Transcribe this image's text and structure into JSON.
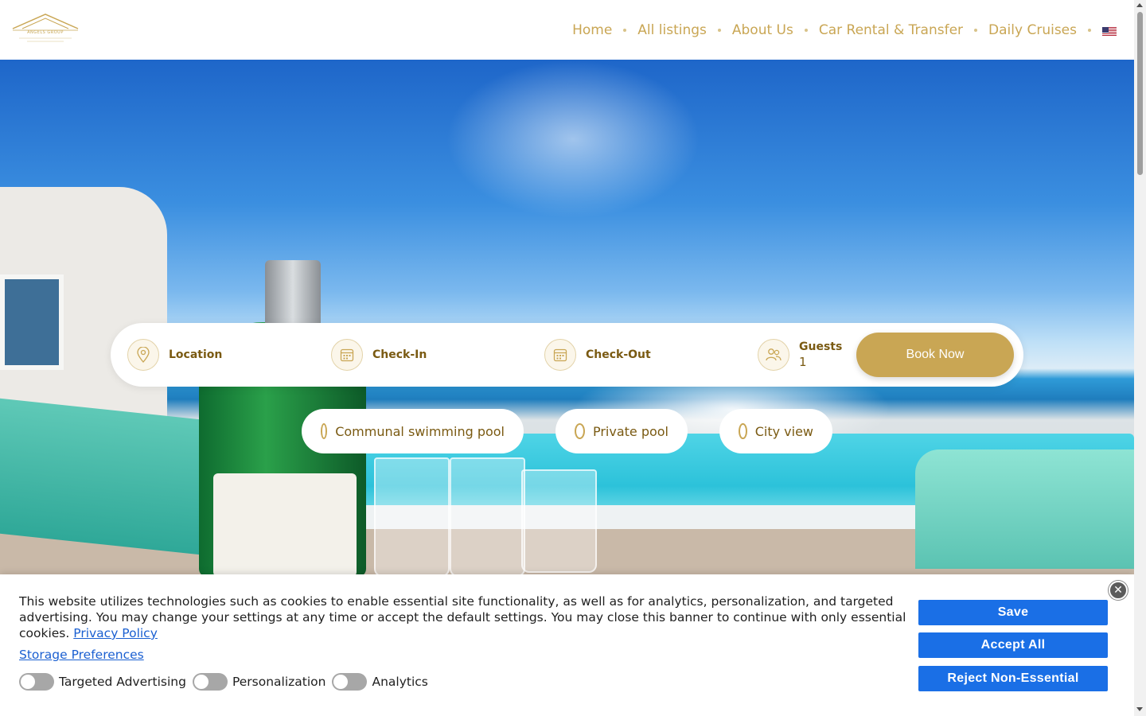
{
  "brand": {
    "logo_text": "ANGELS GROUP",
    "accent": "#c9a654",
    "primary_blue": "#1a6fe6"
  },
  "nav": {
    "items": [
      "Home",
      "All listings",
      "About Us",
      "Car Rental & Transfer",
      "Daily Cruises"
    ],
    "language_icon": "us-flag-icon"
  },
  "search": {
    "location_label": "Location",
    "checkin_label": "Check-In",
    "checkout_label": "Check-Out",
    "guests_label": "Guests",
    "guests_value": "1",
    "book_label": "Book Now"
  },
  "filters": [
    "Communal swimming pool",
    "Private pool",
    "City view"
  ],
  "cookie": {
    "text": "This website utilizes technologies such as cookies to enable essential site functionality, as well as for analytics, personalization, and targeted advertising. You may change your settings at any time or accept the default settings. You may close this banner to continue with only essential cookies.",
    "privacy_link": "Privacy Policy",
    "storage_link": "Storage Preferences",
    "toggles": [
      {
        "label": "Targeted Advertising",
        "enabled": false
      },
      {
        "label": "Personalization",
        "enabled": false
      },
      {
        "label": "Analytics",
        "enabled": false
      }
    ],
    "save_label": "Save",
    "accept_label": "Accept All",
    "reject_label": "Reject Non-Essential",
    "close_icon": "close-icon"
  }
}
